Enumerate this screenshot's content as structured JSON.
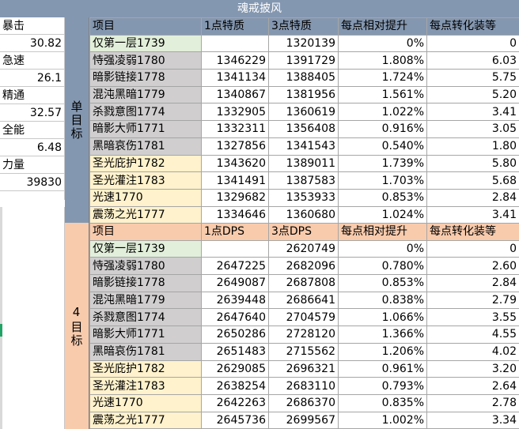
{
  "title": "魂戒披风",
  "stats": [
    {
      "label": "暴击",
      "value": "30.82"
    },
    {
      "label": "急速",
      "value": "26.1"
    },
    {
      "label": "精通",
      "value": "32.57"
    },
    {
      "label": "全能",
      "value": "6.48"
    },
    {
      "label": "力量",
      "value": "39830"
    }
  ],
  "section_a": {
    "label": "单目标",
    "headers": [
      "项目",
      "1点特质",
      "3点特质",
      "每点相对提升",
      "每点转化装等"
    ],
    "rows": [
      {
        "name": "仅第一层1739",
        "c1": "",
        "c3": "1320139",
        "rel": "0%",
        "ilvl": "0",
        "color": "green"
      },
      {
        "name": "恃强凌弱1780",
        "c1": "1346229",
        "c3": "1391729",
        "rel": "1.808%",
        "ilvl": "6.03",
        "color": "grey"
      },
      {
        "name": "暗影链接1778",
        "c1": "1341134",
        "c3": "1388405",
        "rel": "1.724%",
        "ilvl": "5.75",
        "color": "grey"
      },
      {
        "name": "混沌黑暗1779",
        "c1": "1340867",
        "c3": "1381956",
        "rel": "1.561%",
        "ilvl": "5.20",
        "color": "grey"
      },
      {
        "name": "杀戮意图1774",
        "c1": "1332905",
        "c3": "1360619",
        "rel": "1.022%",
        "ilvl": "3.41",
        "color": "grey"
      },
      {
        "name": "暗影大师1771",
        "c1": "1332311",
        "c3": "1356408",
        "rel": "0.916%",
        "ilvl": "3.05",
        "color": "grey"
      },
      {
        "name": "黑暗哀伤1781",
        "c1": "1327856",
        "c3": "1341543",
        "rel": "0.540%",
        "ilvl": "1.80",
        "color": "grey"
      },
      {
        "name": "圣光庇护1782",
        "c1": "1343620",
        "c3": "1389011",
        "rel": "1.739%",
        "ilvl": "5.80",
        "color": "yellow"
      },
      {
        "name": "圣光灌注1783",
        "c1": "1341491",
        "c3": "1387583",
        "rel": "1.703%",
        "ilvl": "5.68",
        "color": "yellow"
      },
      {
        "name": "光速1770",
        "c1": "1329682",
        "c3": "1353933",
        "rel": "0.853%",
        "ilvl": "2.84",
        "color": "yellow"
      },
      {
        "name": "震荡之光1777",
        "c1": "1334646",
        "c3": "1360680",
        "rel": "1.024%",
        "ilvl": "3.41",
        "color": "yellow"
      }
    ]
  },
  "section_b": {
    "label": "4目标",
    "headers": [
      "项目",
      "1点DPS",
      "3点DPS",
      "每点相对提升",
      "每点转化装等"
    ],
    "rows": [
      {
        "name": "仅第一层1739",
        "c1": "",
        "c3": "2620749",
        "rel": "0%",
        "ilvl": "0",
        "color": "green"
      },
      {
        "name": "恃强凌弱1780",
        "c1": "2647225",
        "c3": "2682096",
        "rel": "0.780%",
        "ilvl": "2.60",
        "color": "grey"
      },
      {
        "name": "暗影链接1778",
        "c1": "2649087",
        "c3": "2687808",
        "rel": "0.853%",
        "ilvl": "2.84",
        "color": "grey"
      },
      {
        "name": "混沌黑暗1779",
        "c1": "2639448",
        "c3": "2686641",
        "rel": "0.838%",
        "ilvl": "2.79",
        "color": "grey"
      },
      {
        "name": "杀戮意图1774",
        "c1": "2647640",
        "c3": "2704579",
        "rel": "1.066%",
        "ilvl": "3.55",
        "color": "grey"
      },
      {
        "name": "暗影大师1771",
        "c1": "2650286",
        "c3": "2728120",
        "rel": "1.366%",
        "ilvl": "4.55",
        "color": "grey"
      },
      {
        "name": "黑暗哀伤1781",
        "c1": "2651483",
        "c3": "2715562",
        "rel": "1.206%",
        "ilvl": "4.02",
        "color": "grey"
      },
      {
        "name": "圣光庇护1782",
        "c1": "2629085",
        "c3": "2696321",
        "rel": "0.961%",
        "ilvl": "3.20",
        "color": "yellow"
      },
      {
        "name": "圣光灌注1783",
        "c1": "2638254",
        "c3": "2683110",
        "rel": "0.793%",
        "ilvl": "2.64",
        "color": "yellow"
      },
      {
        "name": "光速1770",
        "c1": "2642263",
        "c3": "2686370",
        "rel": "0.835%",
        "ilvl": "2.78",
        "color": "yellow"
      },
      {
        "name": "震荡之光1777",
        "c1": "2645736",
        "c3": "2699567",
        "rel": "1.002%",
        "ilvl": "3.34",
        "color": "yellow"
      }
    ]
  },
  "colors": {
    "header_blue": "#8497b0",
    "header_peach": "#f8cbad",
    "row_green": "#e2efda",
    "row_grey": "#d0cece",
    "row_yellow": "#fff2cc"
  }
}
